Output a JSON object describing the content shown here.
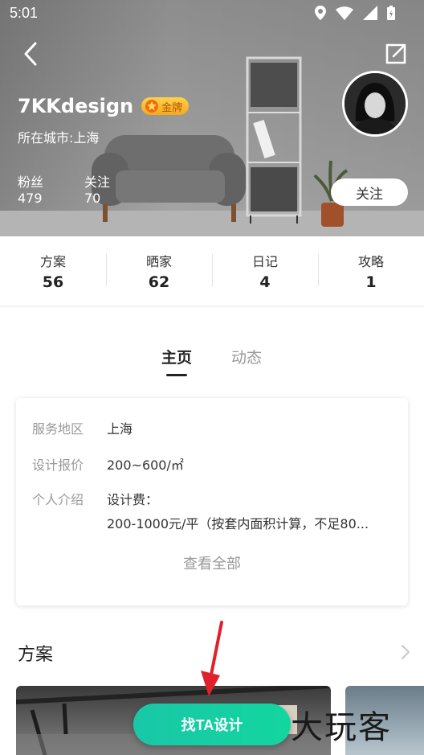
{
  "status_bar": {
    "time": "5:01"
  },
  "profile": {
    "username": "7KKdesign",
    "badge": "金牌",
    "city_label": "所在城市",
    "city": "上海",
    "fans_label": "粉丝",
    "fans": "479",
    "following_label": "关注",
    "following": "70",
    "follow_button": "关注"
  },
  "counts": [
    {
      "label": "方案",
      "value": "56"
    },
    {
      "label": "晒家",
      "value": "62"
    },
    {
      "label": "日记",
      "value": "4"
    },
    {
      "label": "攻略",
      "value": "1"
    }
  ],
  "tabs": {
    "home": "主页",
    "feed": "动态"
  },
  "info": {
    "area_label": "服务地区",
    "area": "上海",
    "price_label": "设计报价",
    "price": "200~600/㎡",
    "intro_label": "个人介绍",
    "intro_line1": "设计费：",
    "intro_line2": "200-1000元/平（按套内面积计算，不足80...",
    "view_all": "查看全部"
  },
  "section": {
    "title": "方案"
  },
  "cta": {
    "label": "找TA设计"
  },
  "watermark": "大玩客",
  "colors": {
    "accent": "#16cda3",
    "badge": "#f7b52a",
    "arrow": "#e0202a"
  }
}
